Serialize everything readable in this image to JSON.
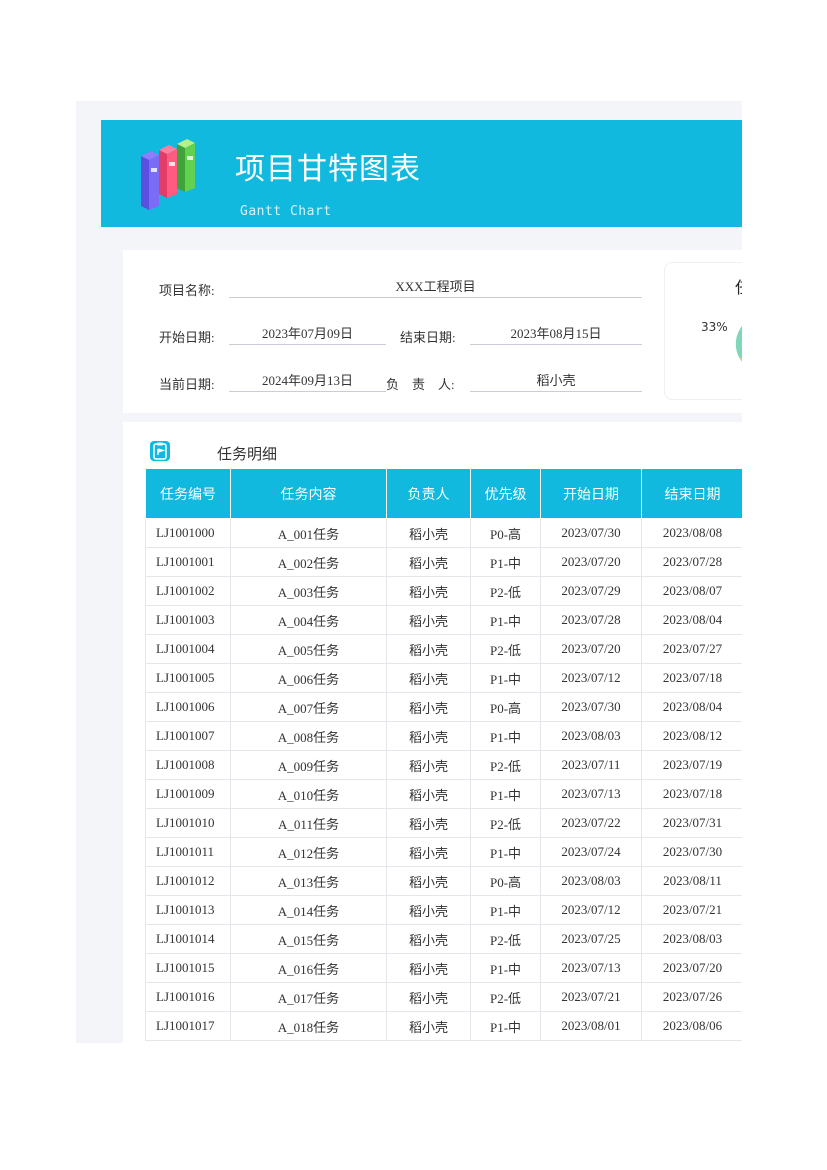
{
  "header": {
    "title": "项目甘特图表",
    "subtitle": "Gantt Chart"
  },
  "project_info": {
    "name_label": "项目名称:",
    "name_value": "XXX工程项目",
    "start_label": "开始日期:",
    "start_value": "2023年07月09日",
    "end_label": "结束日期:",
    "end_value": "2023年08月15日",
    "current_label": "当前日期:",
    "current_value": "2024年09月13日",
    "owner_label": "负　责　人:",
    "owner_value": "稻小壳"
  },
  "pie_card": {
    "title_fragment": "任",
    "percent_label": "33%",
    "colors": [
      "#7ed8b8",
      "#f7c548",
      "#10b9dd"
    ]
  },
  "task_section": {
    "title": "任务明细",
    "icon": "flag-clipboard-icon",
    "columns": [
      "任务编号",
      "任务内容",
      "负责人",
      "优先级",
      "开始日期",
      "结束日期"
    ],
    "rows": [
      [
        "LJ1001000",
        "A_001任务",
        "稻小壳",
        "P0-高",
        "2023/07/30",
        "2023/08/08"
      ],
      [
        "LJ1001001",
        "A_002任务",
        "稻小壳",
        "P1-中",
        "2023/07/20",
        "2023/07/28"
      ],
      [
        "LJ1001002",
        "A_003任务",
        "稻小壳",
        "P2-低",
        "2023/07/29",
        "2023/08/07"
      ],
      [
        "LJ1001003",
        "A_004任务",
        "稻小壳",
        "P1-中",
        "2023/07/28",
        "2023/08/04"
      ],
      [
        "LJ1001004",
        "A_005任务",
        "稻小壳",
        "P2-低",
        "2023/07/20",
        "2023/07/27"
      ],
      [
        "LJ1001005",
        "A_006任务",
        "稻小壳",
        "P1-中",
        "2023/07/12",
        "2023/07/18"
      ],
      [
        "LJ1001006",
        "A_007任务",
        "稻小壳",
        "P0-高",
        "2023/07/30",
        "2023/08/04"
      ],
      [
        "LJ1001007",
        "A_008任务",
        "稻小壳",
        "P1-中",
        "2023/08/03",
        "2023/08/12"
      ],
      [
        "LJ1001008",
        "A_009任务",
        "稻小壳",
        "P2-低",
        "2023/07/11",
        "2023/07/19"
      ],
      [
        "LJ1001009",
        "A_010任务",
        "稻小壳",
        "P1-中",
        "2023/07/13",
        "2023/07/18"
      ],
      [
        "LJ1001010",
        "A_011任务",
        "稻小壳",
        "P2-低",
        "2023/07/22",
        "2023/07/31"
      ],
      [
        "LJ1001011",
        "A_012任务",
        "稻小壳",
        "P1-中",
        "2023/07/24",
        "2023/07/30"
      ],
      [
        "LJ1001012",
        "A_013任务",
        "稻小壳",
        "P0-高",
        "2023/08/03",
        "2023/08/11"
      ],
      [
        "LJ1001013",
        "A_014任务",
        "稻小壳",
        "P1-中",
        "2023/07/12",
        "2023/07/21"
      ],
      [
        "LJ1001014",
        "A_015任务",
        "稻小壳",
        "P2-低",
        "2023/07/25",
        "2023/08/03"
      ],
      [
        "LJ1001015",
        "A_016任务",
        "稻小壳",
        "P1-中",
        "2023/07/13",
        "2023/07/20"
      ],
      [
        "LJ1001016",
        "A_017任务",
        "稻小壳",
        "P2-低",
        "2023/07/21",
        "2023/07/26"
      ],
      [
        "LJ1001017",
        "A_018任务",
        "稻小壳",
        "P1-中",
        "2023/08/01",
        "2023/08/06"
      ]
    ]
  }
}
